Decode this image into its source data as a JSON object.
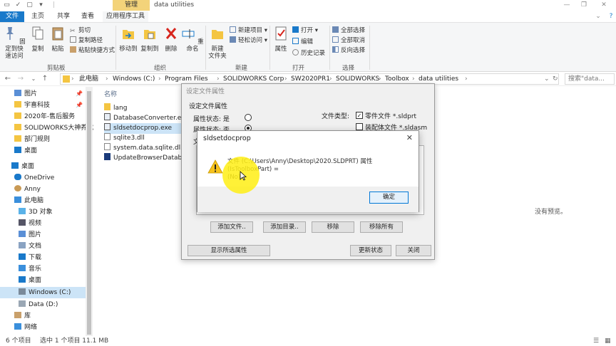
{
  "titlebar": {
    "context_tab": "管理",
    "window_title": "data utilities"
  },
  "ribbon_tabs": [
    "文件",
    "主页",
    "共享",
    "查看",
    "应用程序工具"
  ],
  "ribbon": {
    "clipboard": {
      "pin_label": "固定到快\n速访问",
      "copy_label": "复制",
      "paste_label": "粘贴",
      "cut_label": "剪切",
      "copy_path_label": "复制路径",
      "paste_shortcut_label": "粘贴快捷方式",
      "group_label": "剪贴板"
    },
    "organize": {
      "move_to_label": "移动到",
      "copy_to_label": "复制到",
      "delete_label": "删除",
      "rename_label": "重命名",
      "group_label": "组织"
    },
    "new": {
      "new_folder_label": "新建\n文件夹",
      "new_item_label": "新建项目",
      "easy_access_label": "轻松访问",
      "group_label": "新建"
    },
    "open": {
      "properties_label": "属性",
      "open_label": "打开",
      "edit_label": "编辑",
      "history_label": "历史记录",
      "group_label": "打开"
    },
    "select": {
      "select_all_label": "全部选择",
      "select_none_label": "全部取消",
      "invert_label": "反向选择",
      "group_label": "选择"
    }
  },
  "address": {
    "crumbs": [
      "此电脑",
      "Windows (C:)",
      "Program Files",
      "SOLIDWORKS Corp",
      "SW2020PR1",
      "SOLIDWORKS",
      "Toolbox",
      "data utilities"
    ],
    "search_placeholder": "搜索\"data..."
  },
  "nav": {
    "items": [
      {
        "label": "图片",
        "pinned": true
      },
      {
        "label": "宇喜科技",
        "pinned": true
      },
      {
        "label": "2020年-售后服务",
        "pinned": false
      },
      {
        "label": "SOLIDWORKS大神养成",
        "pinned": false
      },
      {
        "label": "部门规则",
        "pinned": false
      },
      {
        "label": "桌面",
        "pinned": false
      },
      {
        "label": "桌面",
        "pinned": false
      },
      {
        "label": "OneDrive",
        "pinned": false
      },
      {
        "label": "Anny",
        "pinned": false
      },
      {
        "label": "此电脑",
        "pinned": false
      },
      {
        "label": "3D 对象",
        "pinned": false
      },
      {
        "label": "视频",
        "pinned": false
      },
      {
        "label": "图片",
        "pinned": false
      },
      {
        "label": "文档",
        "pinned": false
      },
      {
        "label": "下载",
        "pinned": false
      },
      {
        "label": "音乐",
        "pinned": false
      },
      {
        "label": "桌面",
        "pinned": false
      },
      {
        "label": "Windows (C:)",
        "pinned": false
      },
      {
        "label": "Data (D:)",
        "pinned": false
      },
      {
        "label": "库",
        "pinned": false
      },
      {
        "label": "网络",
        "pinned": false
      }
    ]
  },
  "filelist": {
    "column_name": "名称",
    "files": [
      "lang",
      "DatabaseConverter.exe",
      "sldsetdocprop.exe",
      "sqlite3.dll",
      "system.data.sqlite.dll",
      "UpdateBrowserDatabase"
    ]
  },
  "preview": {
    "empty_text": "没有预览。"
  },
  "statusbar": {
    "item_count": "6 个项目",
    "selection": "选中 1 个项目  11.1 MB"
  },
  "back_dialog": {
    "title": "设定文件属性",
    "section_label": "设定文件属性",
    "prop_yes_label": "属性状态: 是",
    "prop_no_label": "属性状态: 否",
    "partial_label": "文",
    "file_type_label": "文件类型:",
    "part_checkbox_label": "零件文件 *.sldprt",
    "assembly_checkbox_label": "装配体文件 *.sldasm",
    "add_file_label": "添加文件..",
    "add_dir_label": "添加目录..",
    "remove_label": "移除",
    "remove_all_label": "移除所有",
    "show_props_label": "显示所选属性",
    "update_label": "更新状态",
    "close_label": "关闭"
  },
  "message_box": {
    "title": "sldsetdocprop",
    "message_line1": "文件 (C:\\Users\\Anny\\Desktop\\2020.SLDPRT) 属性 (IsToolboxPart) =",
    "message_line2": "(No)",
    "ok_label": "确定"
  },
  "colors": {
    "file_tab": "#1979ca",
    "context_tab": "#f3d37a",
    "selection": "#cce4f7",
    "cursor_halo": "#ffee14"
  }
}
